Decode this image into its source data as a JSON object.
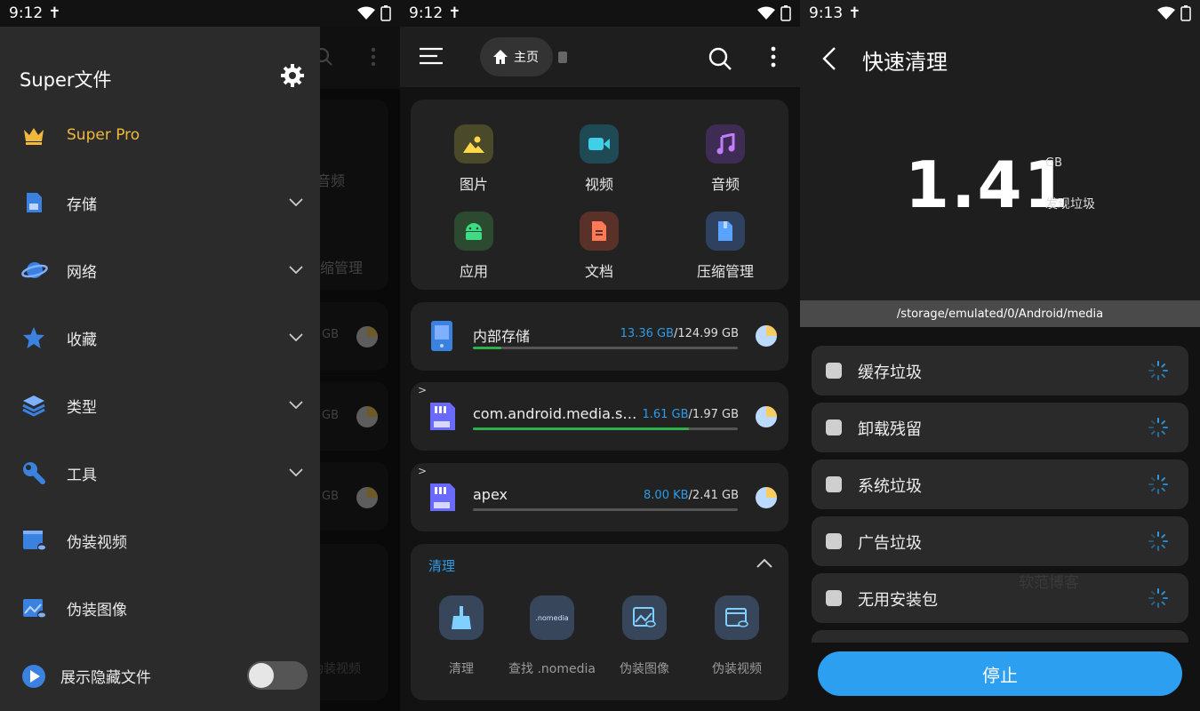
{
  "screen1": {
    "status": {
      "time": "9:12"
    },
    "drawer": {
      "title": "Super文件",
      "items": [
        {
          "label": "Super Pro",
          "icon": "crown-icon"
        },
        {
          "label": "存储",
          "icon": "storage-icon"
        },
        {
          "label": "网络",
          "icon": "network-icon"
        },
        {
          "label": "收藏",
          "icon": "star-icon"
        },
        {
          "label": "类型",
          "icon": "layers-icon"
        },
        {
          "label": "工具",
          "icon": "wrench-icon"
        },
        {
          "label": "伪装视频",
          "icon": "disguise-video-icon"
        },
        {
          "label": "伪装图像",
          "icon": "disguise-image-icon"
        }
      ],
      "toggle_label": "展示隐藏文件",
      "toggle_on": false
    },
    "behind": {
      "audio_label": "音频",
      "zip_label": "缩管理",
      "gb1": "GB",
      "gb2": "GB",
      "gb3": "GB",
      "video_label": "伪装视频"
    }
  },
  "screen2": {
    "status": {
      "time": "9:12"
    },
    "toolbar": {
      "home_chip": "主页"
    },
    "categories": [
      {
        "label": "图片",
        "color": "#4a4a2a"
      },
      {
        "label": "视频",
        "color": "#1f4a55"
      },
      {
        "label": "音频",
        "color": "#3f2c55"
      },
      {
        "label": "应用",
        "color": "#2b4a2f"
      },
      {
        "label": "文档",
        "color": "#5a3128"
      },
      {
        "label": "压缩管理",
        "color": "#2e4260"
      }
    ],
    "storage": [
      {
        "name": "内部存储",
        "used": "13.36 GB",
        "total": "/124.99 GB",
        "fill": 0.107
      },
      {
        "name": "com.android.media.swcodec",
        "used": "1.61 GB",
        "total": "/1.97 GB",
        "fill": 0.817
      },
      {
        "name": "apex",
        "used": "8.00 KB",
        "total": "/2.41 GB",
        "fill": 0.0
      }
    ],
    "clean": {
      "title": "清理",
      "items": [
        {
          "label": "清理",
          "icon": "broom-icon"
        },
        {
          "label": "查找 .nomedia",
          "icon": "nomedia-icon"
        },
        {
          "label": "伪装图像",
          "icon": "disguise-image-icon"
        },
        {
          "label": "伪装视频",
          "icon": "disguise-video-icon"
        }
      ]
    }
  },
  "screen3": {
    "status": {
      "time": "9:13"
    },
    "title": "快速清理",
    "amount": "1.41",
    "unit": "GB",
    "found_label": "发现垃圾",
    "path": "/storage/emulated/0/Android/media",
    "rows": [
      {
        "label": "缓存垃圾"
      },
      {
        "label": "卸载残留"
      },
      {
        "label": "系统垃圾"
      },
      {
        "label": "广告垃圾"
      },
      {
        "label": "无用安装包"
      }
    ],
    "watermark": "软范博客",
    "stop_label": "停止"
  },
  "colors": {
    "accent": "#2e9be6",
    "gold": "#f0b93c",
    "progress": "#2fb04a",
    "button": "#2d9ff0"
  }
}
